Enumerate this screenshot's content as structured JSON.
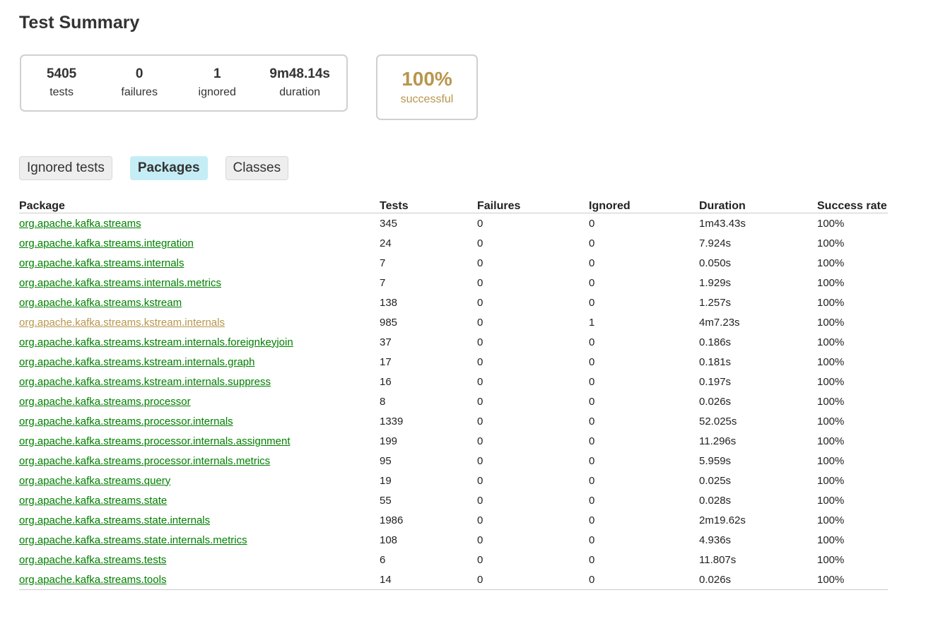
{
  "title": "Test Summary",
  "summary": {
    "tests": {
      "value": "5405",
      "label": "tests"
    },
    "failures": {
      "value": "0",
      "label": "failures"
    },
    "ignored": {
      "value": "1",
      "label": "ignored"
    },
    "duration": {
      "value": "9m48.14s",
      "label": "duration"
    },
    "success": {
      "value": "100%",
      "label": "successful"
    }
  },
  "tabs": [
    {
      "label": "Ignored tests",
      "selected": false
    },
    {
      "label": "Packages",
      "selected": true
    },
    {
      "label": "Classes",
      "selected": false
    }
  ],
  "table": {
    "headers": [
      "Package",
      "Tests",
      "Failures",
      "Ignored",
      "Duration",
      "Success rate"
    ],
    "rows": [
      {
        "package": "org.apache.kafka.streams",
        "tests": "345",
        "failures": "0",
        "ignored": "0",
        "duration": "1m43.43s",
        "rate": "100%"
      },
      {
        "package": "org.apache.kafka.streams.integration",
        "tests": "24",
        "failures": "0",
        "ignored": "0",
        "duration": "7.924s",
        "rate": "100%"
      },
      {
        "package": "org.apache.kafka.streams.internals",
        "tests": "7",
        "failures": "0",
        "ignored": "0",
        "duration": "0.050s",
        "rate": "100%"
      },
      {
        "package": "org.apache.kafka.streams.internals.metrics",
        "tests": "7",
        "failures": "0",
        "ignored": "0",
        "duration": "1.929s",
        "rate": "100%"
      },
      {
        "package": "org.apache.kafka.streams.kstream",
        "tests": "138",
        "failures": "0",
        "ignored": "0",
        "duration": "1.257s",
        "rate": "100%"
      },
      {
        "package": "org.apache.kafka.streams.kstream.internals",
        "tests": "985",
        "failures": "0",
        "ignored": "1",
        "duration": "4m7.23s",
        "rate": "100%",
        "has_ignored": true
      },
      {
        "package": "org.apache.kafka.streams.kstream.internals.foreignkeyjoin",
        "tests": "37",
        "failures": "0",
        "ignored": "0",
        "duration": "0.186s",
        "rate": "100%"
      },
      {
        "package": "org.apache.kafka.streams.kstream.internals.graph",
        "tests": "17",
        "failures": "0",
        "ignored": "0",
        "duration": "0.181s",
        "rate": "100%"
      },
      {
        "package": "org.apache.kafka.streams.kstream.internals.suppress",
        "tests": "16",
        "failures": "0",
        "ignored": "0",
        "duration": "0.197s",
        "rate": "100%"
      },
      {
        "package": "org.apache.kafka.streams.processor",
        "tests": "8",
        "failures": "0",
        "ignored": "0",
        "duration": "0.026s",
        "rate": "100%"
      },
      {
        "package": "org.apache.kafka.streams.processor.internals",
        "tests": "1339",
        "failures": "0",
        "ignored": "0",
        "duration": "52.025s",
        "rate": "100%"
      },
      {
        "package": "org.apache.kafka.streams.processor.internals.assignment",
        "tests": "199",
        "failures": "0",
        "ignored": "0",
        "duration": "11.296s",
        "rate": "100%"
      },
      {
        "package": "org.apache.kafka.streams.processor.internals.metrics",
        "tests": "95",
        "failures": "0",
        "ignored": "0",
        "duration": "5.959s",
        "rate": "100%"
      },
      {
        "package": "org.apache.kafka.streams.query",
        "tests": "19",
        "failures": "0",
        "ignored": "0",
        "duration": "0.025s",
        "rate": "100%"
      },
      {
        "package": "org.apache.kafka.streams.state",
        "tests": "55",
        "failures": "0",
        "ignored": "0",
        "duration": "0.028s",
        "rate": "100%"
      },
      {
        "package": "org.apache.kafka.streams.state.internals",
        "tests": "1986",
        "failures": "0",
        "ignored": "0",
        "duration": "2m19.62s",
        "rate": "100%"
      },
      {
        "package": "org.apache.kafka.streams.state.internals.metrics",
        "tests": "108",
        "failures": "0",
        "ignored": "0",
        "duration": "4.936s",
        "rate": "100%"
      },
      {
        "package": "org.apache.kafka.streams.tests",
        "tests": "6",
        "failures": "0",
        "ignored": "0",
        "duration": "11.807s",
        "rate": "100%"
      },
      {
        "package": "org.apache.kafka.streams.tools",
        "tests": "14",
        "failures": "0",
        "ignored": "0",
        "duration": "0.026s",
        "rate": "100%"
      }
    ]
  },
  "colors": {
    "link": "#008000",
    "ignored_accent": "#b8964e",
    "selected_tab": "#c5edf5"
  }
}
